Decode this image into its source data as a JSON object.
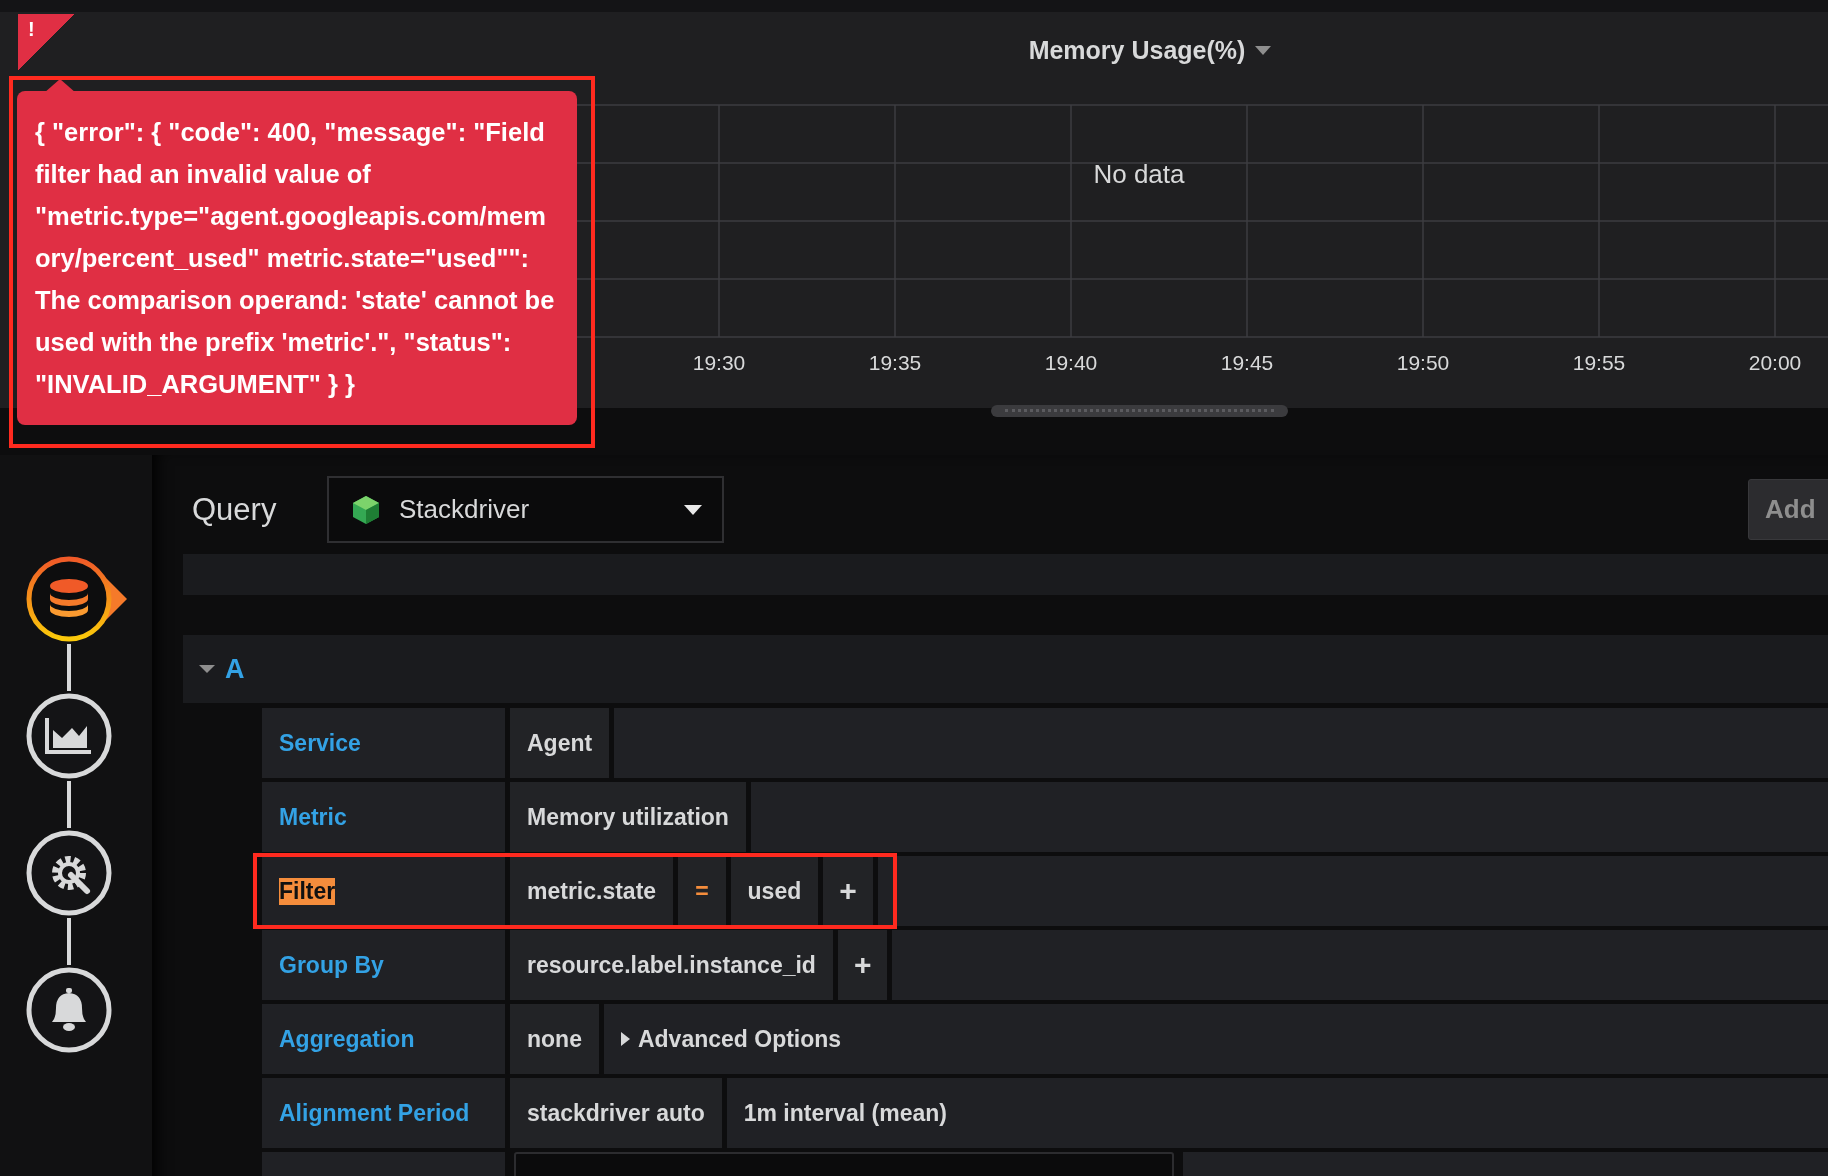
{
  "panel": {
    "title": "Memory Usage(%)",
    "no_data": "No data",
    "x_ticks": [
      "19:30",
      "19:35",
      "19:40",
      "19:45",
      "19:50",
      "19:55",
      "20:00"
    ],
    "error": {
      "icon": "!",
      "message": "{ \"error\": { \"code\": 400, \"message\": \"Field filter had an invalid value of \"metric.type=\"agent.googleapis.com/memory/percent_used\" metric.state=\"used\"\": The comparison operand: 'state' cannot be used with the prefix 'metric'.\", \"status\": \"INVALID_ARGUMENT\" } }",
      "annotated": true
    }
  },
  "sidebar": [
    {
      "kind": "queries",
      "selected": true
    },
    {
      "kind": "visualization",
      "selected": false
    },
    {
      "kind": "general",
      "selected": false
    },
    {
      "kind": "alert",
      "selected": false
    }
  ],
  "query": {
    "title": "Query",
    "datasource": "Stackdriver",
    "add_button": "Add"
  },
  "query_row": {
    "ref": "A",
    "expanded": true,
    "fields": [
      {
        "label": "Service",
        "highlighted": false,
        "annotated": false,
        "segments": [
          {
            "kind": "value",
            "text": "Agent"
          },
          {
            "kind": "fill"
          }
        ]
      },
      {
        "label": "Metric",
        "highlighted": false,
        "annotated": false,
        "segments": [
          {
            "kind": "value",
            "text": "Memory utilization"
          },
          {
            "kind": "fill"
          }
        ]
      },
      {
        "label": "Filter",
        "highlighted": true,
        "annotated": true,
        "segments": [
          {
            "kind": "value",
            "text": "metric.state"
          },
          {
            "kind": "operator",
            "text": "="
          },
          {
            "kind": "value",
            "text": "used"
          },
          {
            "kind": "plus",
            "text": "+"
          },
          {
            "kind": "fill"
          }
        ]
      },
      {
        "label": "Group By",
        "highlighted": false,
        "annotated": false,
        "segments": [
          {
            "kind": "value",
            "text": "resource.label.instance_id"
          },
          {
            "kind": "plus",
            "text": "+"
          },
          {
            "kind": "fill"
          }
        ]
      },
      {
        "label": "Aggregation",
        "highlighted": false,
        "annotated": false,
        "segments": [
          {
            "kind": "value",
            "text": "none"
          },
          {
            "kind": "toggle",
            "text": "Advanced Options"
          }
        ]
      },
      {
        "label": "Alignment Period",
        "highlighted": false,
        "annotated": false,
        "segments": [
          {
            "kind": "value",
            "text": "stackdriver auto"
          },
          {
            "kind": "info",
            "text": "1m interval (mean)"
          }
        ]
      },
      {
        "annotated": false,
        "segments": [
          {
            "kind": "input"
          },
          {
            "kind": "fill"
          }
        ]
      }
    ]
  }
}
